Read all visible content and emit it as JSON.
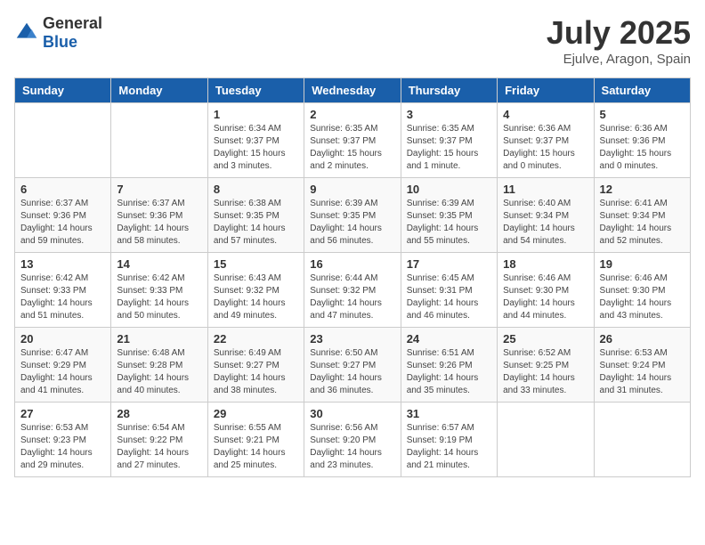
{
  "header": {
    "logo_general": "General",
    "logo_blue": "Blue",
    "month_title": "July 2025",
    "location": "Ejulve, Aragon, Spain"
  },
  "days_of_week": [
    "Sunday",
    "Monday",
    "Tuesday",
    "Wednesday",
    "Thursday",
    "Friday",
    "Saturday"
  ],
  "weeks": [
    [
      {
        "day": "",
        "content": ""
      },
      {
        "day": "",
        "content": ""
      },
      {
        "day": "1",
        "content": "Sunrise: 6:34 AM\nSunset: 9:37 PM\nDaylight: 15 hours and 3 minutes."
      },
      {
        "day": "2",
        "content": "Sunrise: 6:35 AM\nSunset: 9:37 PM\nDaylight: 15 hours and 2 minutes."
      },
      {
        "day": "3",
        "content": "Sunrise: 6:35 AM\nSunset: 9:37 PM\nDaylight: 15 hours and 1 minute."
      },
      {
        "day": "4",
        "content": "Sunrise: 6:36 AM\nSunset: 9:37 PM\nDaylight: 15 hours and 0 minutes."
      },
      {
        "day": "5",
        "content": "Sunrise: 6:36 AM\nSunset: 9:36 PM\nDaylight: 15 hours and 0 minutes."
      }
    ],
    [
      {
        "day": "6",
        "content": "Sunrise: 6:37 AM\nSunset: 9:36 PM\nDaylight: 14 hours and 59 minutes."
      },
      {
        "day": "7",
        "content": "Sunrise: 6:37 AM\nSunset: 9:36 PM\nDaylight: 14 hours and 58 minutes."
      },
      {
        "day": "8",
        "content": "Sunrise: 6:38 AM\nSunset: 9:35 PM\nDaylight: 14 hours and 57 minutes."
      },
      {
        "day": "9",
        "content": "Sunrise: 6:39 AM\nSunset: 9:35 PM\nDaylight: 14 hours and 56 minutes."
      },
      {
        "day": "10",
        "content": "Sunrise: 6:39 AM\nSunset: 9:35 PM\nDaylight: 14 hours and 55 minutes."
      },
      {
        "day": "11",
        "content": "Sunrise: 6:40 AM\nSunset: 9:34 PM\nDaylight: 14 hours and 54 minutes."
      },
      {
        "day": "12",
        "content": "Sunrise: 6:41 AM\nSunset: 9:34 PM\nDaylight: 14 hours and 52 minutes."
      }
    ],
    [
      {
        "day": "13",
        "content": "Sunrise: 6:42 AM\nSunset: 9:33 PM\nDaylight: 14 hours and 51 minutes."
      },
      {
        "day": "14",
        "content": "Sunrise: 6:42 AM\nSunset: 9:33 PM\nDaylight: 14 hours and 50 minutes."
      },
      {
        "day": "15",
        "content": "Sunrise: 6:43 AM\nSunset: 9:32 PM\nDaylight: 14 hours and 49 minutes."
      },
      {
        "day": "16",
        "content": "Sunrise: 6:44 AM\nSunset: 9:32 PM\nDaylight: 14 hours and 47 minutes."
      },
      {
        "day": "17",
        "content": "Sunrise: 6:45 AM\nSunset: 9:31 PM\nDaylight: 14 hours and 46 minutes."
      },
      {
        "day": "18",
        "content": "Sunrise: 6:46 AM\nSunset: 9:30 PM\nDaylight: 14 hours and 44 minutes."
      },
      {
        "day": "19",
        "content": "Sunrise: 6:46 AM\nSunset: 9:30 PM\nDaylight: 14 hours and 43 minutes."
      }
    ],
    [
      {
        "day": "20",
        "content": "Sunrise: 6:47 AM\nSunset: 9:29 PM\nDaylight: 14 hours and 41 minutes."
      },
      {
        "day": "21",
        "content": "Sunrise: 6:48 AM\nSunset: 9:28 PM\nDaylight: 14 hours and 40 minutes."
      },
      {
        "day": "22",
        "content": "Sunrise: 6:49 AM\nSunset: 9:27 PM\nDaylight: 14 hours and 38 minutes."
      },
      {
        "day": "23",
        "content": "Sunrise: 6:50 AM\nSunset: 9:27 PM\nDaylight: 14 hours and 36 minutes."
      },
      {
        "day": "24",
        "content": "Sunrise: 6:51 AM\nSunset: 9:26 PM\nDaylight: 14 hours and 35 minutes."
      },
      {
        "day": "25",
        "content": "Sunrise: 6:52 AM\nSunset: 9:25 PM\nDaylight: 14 hours and 33 minutes."
      },
      {
        "day": "26",
        "content": "Sunrise: 6:53 AM\nSunset: 9:24 PM\nDaylight: 14 hours and 31 minutes."
      }
    ],
    [
      {
        "day": "27",
        "content": "Sunrise: 6:53 AM\nSunset: 9:23 PM\nDaylight: 14 hours and 29 minutes."
      },
      {
        "day": "28",
        "content": "Sunrise: 6:54 AM\nSunset: 9:22 PM\nDaylight: 14 hours and 27 minutes."
      },
      {
        "day": "29",
        "content": "Sunrise: 6:55 AM\nSunset: 9:21 PM\nDaylight: 14 hours and 25 minutes."
      },
      {
        "day": "30",
        "content": "Sunrise: 6:56 AM\nSunset: 9:20 PM\nDaylight: 14 hours and 23 minutes."
      },
      {
        "day": "31",
        "content": "Sunrise: 6:57 AM\nSunset: 9:19 PM\nDaylight: 14 hours and 21 minutes."
      },
      {
        "day": "",
        "content": ""
      },
      {
        "day": "",
        "content": ""
      }
    ]
  ]
}
